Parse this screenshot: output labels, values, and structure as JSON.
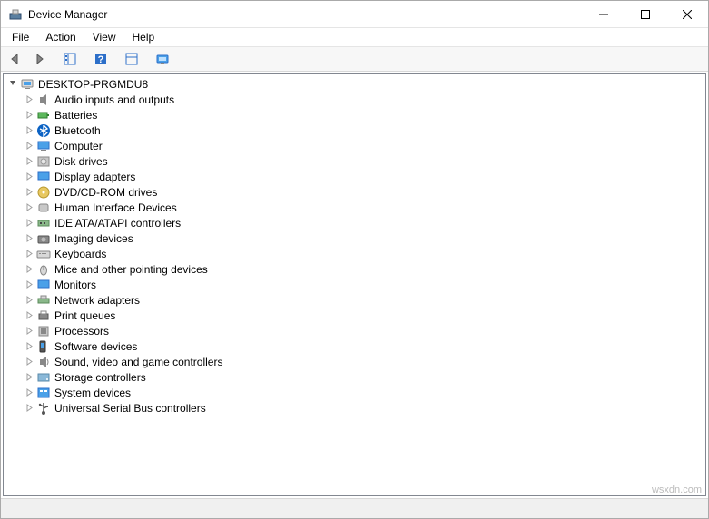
{
  "window": {
    "title": "Device Manager"
  },
  "menus": {
    "file": "File",
    "action": "Action",
    "view": "View",
    "help": "Help"
  },
  "tree": {
    "root": "DESKTOP-PRGMDU8",
    "items": [
      {
        "label": "Audio inputs and outputs",
        "icon": "audio"
      },
      {
        "label": "Batteries",
        "icon": "battery"
      },
      {
        "label": "Bluetooth",
        "icon": "bluetooth"
      },
      {
        "label": "Computer",
        "icon": "computer"
      },
      {
        "label": "Disk drives",
        "icon": "disk"
      },
      {
        "label": "Display adapters",
        "icon": "display"
      },
      {
        "label": "DVD/CD-ROM drives",
        "icon": "dvd"
      },
      {
        "label": "Human Interface Devices",
        "icon": "hid"
      },
      {
        "label": "IDE ATA/ATAPI controllers",
        "icon": "ide"
      },
      {
        "label": "Imaging devices",
        "icon": "imaging"
      },
      {
        "label": "Keyboards",
        "icon": "keyboard"
      },
      {
        "label": "Mice and other pointing devices",
        "icon": "mouse"
      },
      {
        "label": "Monitors",
        "icon": "monitor"
      },
      {
        "label": "Network adapters",
        "icon": "network"
      },
      {
        "label": "Print queues",
        "icon": "printer"
      },
      {
        "label": "Processors",
        "icon": "cpu"
      },
      {
        "label": "Software devices",
        "icon": "software"
      },
      {
        "label": "Sound, video and game controllers",
        "icon": "sound"
      },
      {
        "label": "Storage controllers",
        "icon": "storage"
      },
      {
        "label": "System devices",
        "icon": "system"
      },
      {
        "label": "Universal Serial Bus controllers",
        "icon": "usb"
      }
    ]
  },
  "watermark": "wsxdn.com"
}
